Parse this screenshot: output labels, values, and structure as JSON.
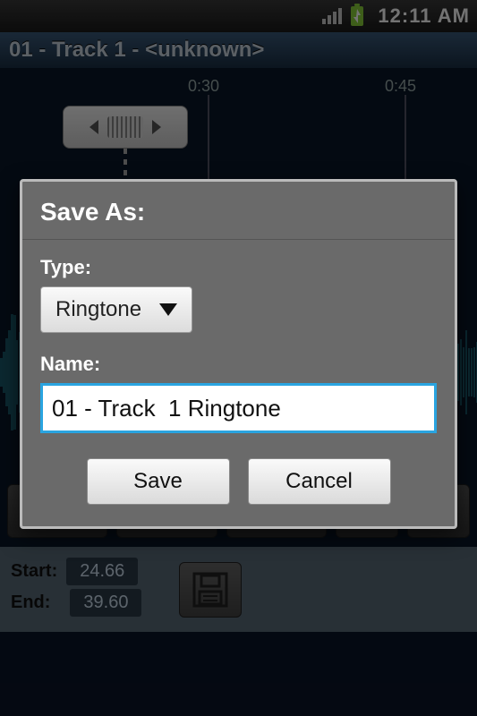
{
  "statusbar": {
    "time": "12:11 AM"
  },
  "titlebar": {
    "title": "01 - Track  1 - <unknown>"
  },
  "timeline": {
    "marker1": "0:30",
    "marker2": "0:45"
  },
  "timeinputs": {
    "start_label": "Start:",
    "end_label": "End:",
    "start_value": "24.66",
    "end_value": "39.60"
  },
  "dialog": {
    "title": "Save As:",
    "type_label": "Type:",
    "type_value": "Ringtone",
    "name_label": "Name:",
    "name_value": "01 - Track  1 Ringtone",
    "save_label": "Save",
    "cancel_label": "Cancel"
  }
}
